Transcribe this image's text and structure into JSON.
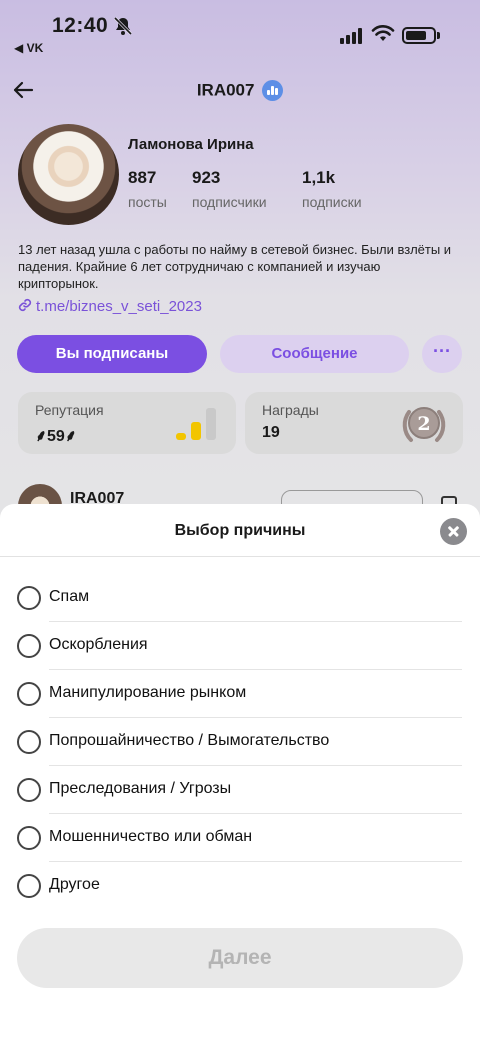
{
  "status_bar": {
    "time": "12:40",
    "back_app": "◀ VK"
  },
  "header": {
    "username": "IRA007",
    "back_icon": "arrow-left-icon",
    "verified_icon": "verified-chart-badge-icon"
  },
  "profile": {
    "full_name": "Ламонова Ирина",
    "stats": [
      {
        "value": "887",
        "label": "посты"
      },
      {
        "value": "923",
        "label": "подписчики"
      },
      {
        "value": "1,1k",
        "label": "подписки"
      }
    ],
    "bio": "13 лет назад ушла с работы по найму в сетевой бизнес. Были взлёты и падения. Крайние 6 лет сотрудничаю с компанией и изучаю крипторынок.",
    "link": "t.me/biznes_v_seti_2023"
  },
  "actions": {
    "subscribed_label": "Вы подписаны",
    "message_label": "Сообщение",
    "more_label": "···"
  },
  "cards": {
    "reputation": {
      "title": "Репутация",
      "value": "⸙59⸙"
    },
    "awards": {
      "title": "Награды",
      "value": "19",
      "medal_number": "2"
    }
  },
  "post": {
    "author": "IRA007"
  },
  "sheet": {
    "title": "Выбор причины",
    "options": [
      "Спам",
      "Оскорбления",
      "Манипулирование рынком",
      "Попрошайничество / Вымогательство",
      "Преследования / Угрозы",
      "Мошенничество или обман",
      "Другое"
    ],
    "next_label": "Далее"
  },
  "colors": {
    "accent": "#7b4fe2",
    "accent_light": "#dcd0ef",
    "reputation_bar": "#f2c500",
    "verified": "#5d8fe6"
  }
}
